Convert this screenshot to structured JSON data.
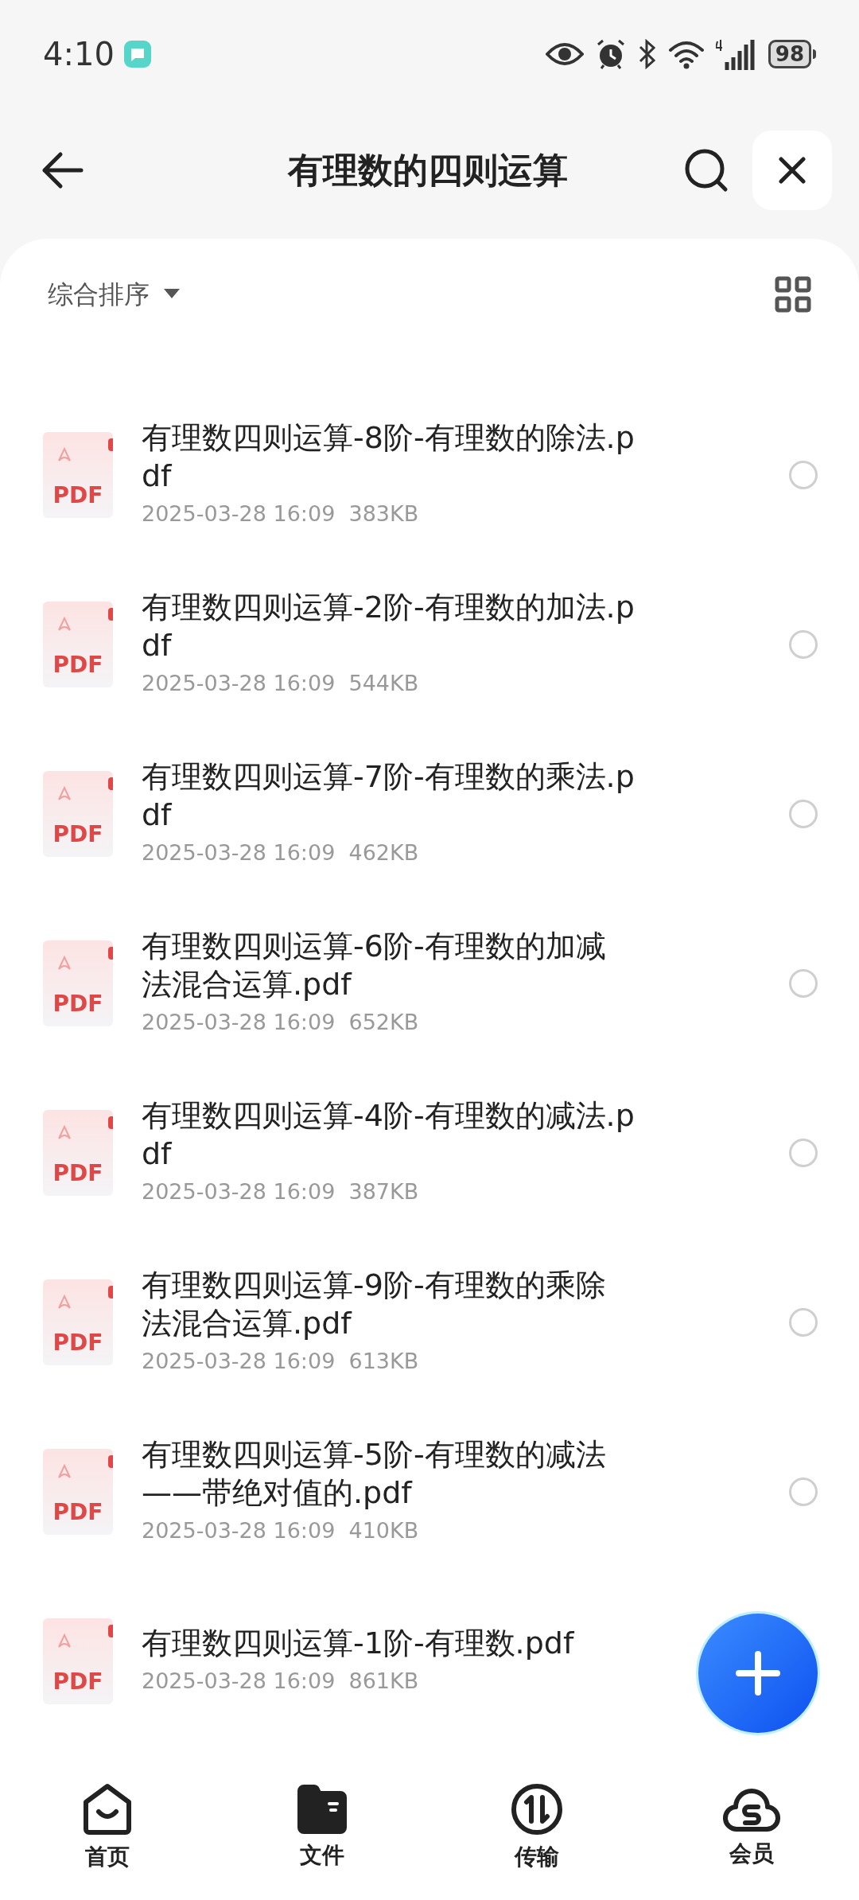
{
  "status_bar": {
    "time": "4:10",
    "battery": "98"
  },
  "header": {
    "title": "有理数的四则运算"
  },
  "toolbar": {
    "sort_label": "综合排序"
  },
  "files": [
    {
      "name": "有理数四则运算-8阶-有理数的除法.pdf",
      "meta": "2025-03-28 16:09  383KB",
      "selected": false
    },
    {
      "name": "有理数四则运算-2阶-有理数的加法.pdf",
      "meta": "2025-03-28 16:09  544KB",
      "selected": false
    },
    {
      "name": "有理数四则运算-7阶-有理数的乘法.pdf",
      "meta": "2025-03-28 16:09  462KB",
      "selected": false
    },
    {
      "name": "有理数四则运算-6阶-有理数的加减法混合运算.pdf",
      "meta": "2025-03-28 16:09  652KB",
      "selected": false
    },
    {
      "name": "有理数四则运算-4阶-有理数的减法.pdf",
      "meta": "2025-03-28 16:09  387KB",
      "selected": false
    },
    {
      "name": "有理数四则运算-9阶-有理数的乘除法混合运算.pdf",
      "meta": "2025-03-28 16:09  613KB",
      "selected": false
    },
    {
      "name": "有理数四则运算-5阶-有理数的减法——带绝对值的.pdf",
      "meta": "2025-03-28 16:09  410KB",
      "selected": false
    },
    {
      "name": "有理数四则运算-1阶-有理数.pdf",
      "meta": "2025-03-28 16:09  861KB"
    }
  ],
  "file_badges": [
    "PDF",
    "PDF",
    "PDF",
    "PDF",
    "PDF",
    "PDF",
    "PDF",
    "PDF"
  ],
  "bottom_nav": [
    {
      "label": "首页",
      "kind": "home",
      "selected": false
    },
    {
      "label": "文件",
      "kind": "files",
      "selected": true
    },
    {
      "label": "传输",
      "kind": "transfer",
      "selected": false
    },
    {
      "label": "会员",
      "kind": "vip",
      "selected": false
    }
  ]
}
